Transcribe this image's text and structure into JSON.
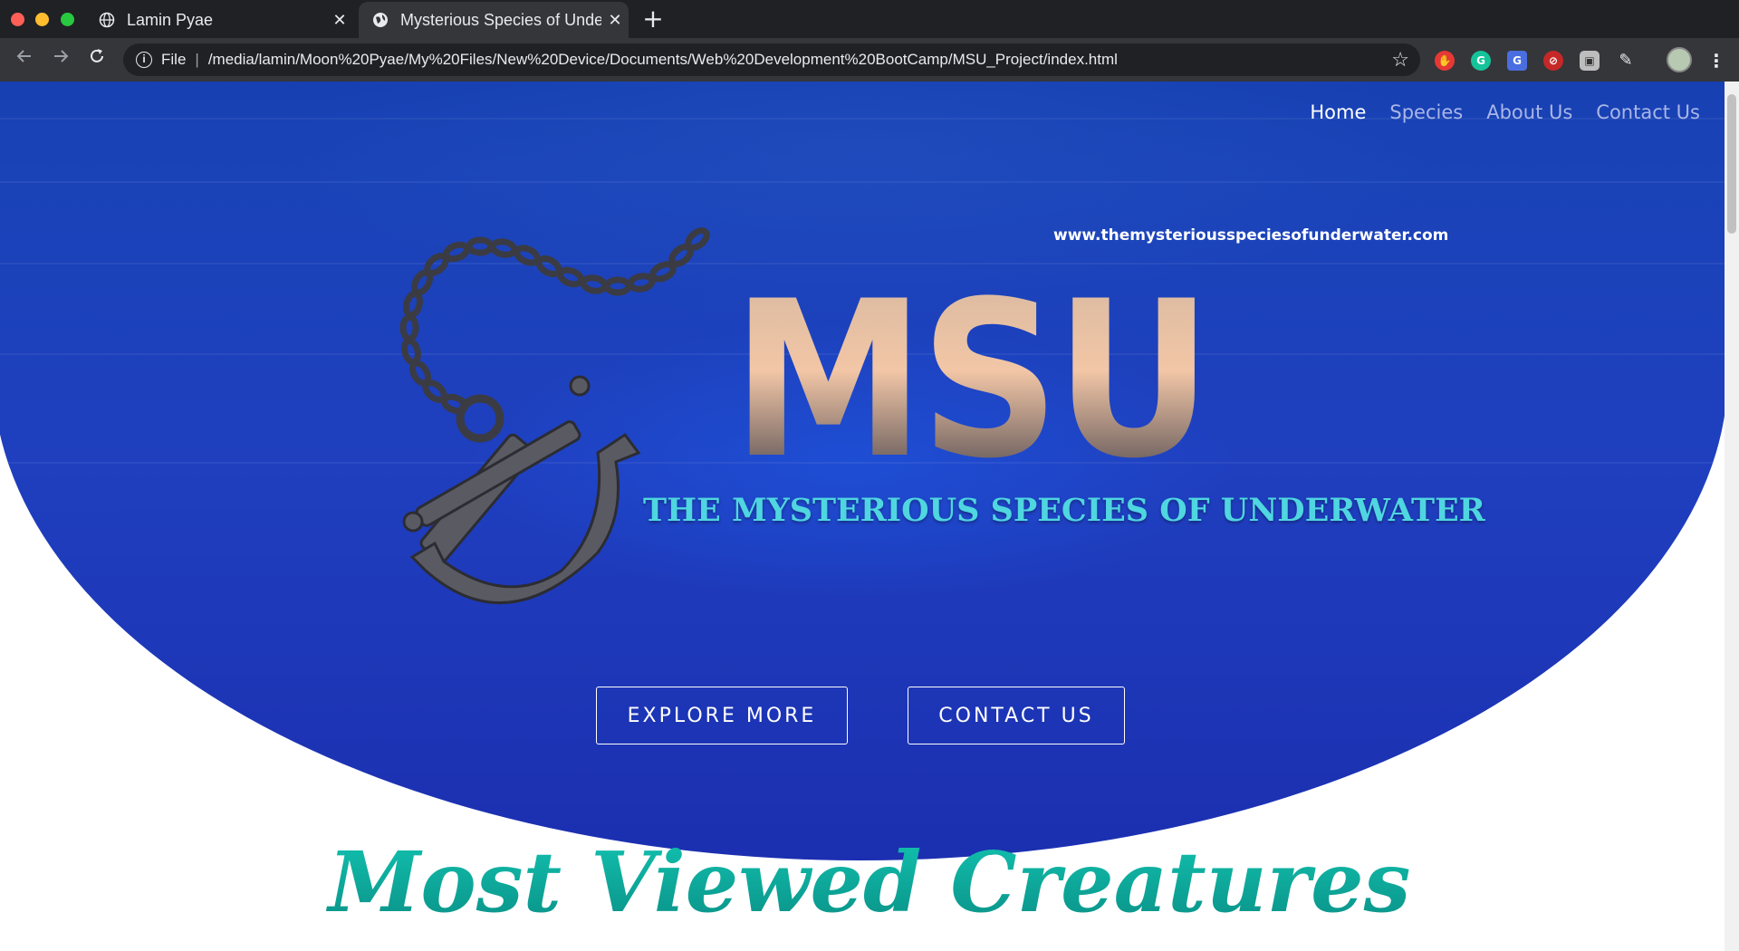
{
  "browser": {
    "tabs": [
      {
        "title": "Lamin Pyae",
        "icon": "globe-icon",
        "active": false
      },
      {
        "title": "Mysterious Species of Underwater",
        "icon": "globe-icon",
        "active": true
      }
    ],
    "close_glyph": "✕",
    "new_tab_glyph": "+",
    "address": {
      "scheme_label": "File",
      "separator": "|",
      "url": "/media/lamin/Moon%20Pyae/My%20Files/New%20Device/Documents/Web%20Development%20BootCamp/MSU_Project/index.html"
    }
  },
  "nav": {
    "items": [
      "Home",
      "Species",
      "About Us",
      "Contact Us"
    ],
    "active_index": 0
  },
  "hero": {
    "site_url": "www.themysteriousspeciesofunderwater.com",
    "logo_text": "MSU",
    "tagline": "THE MYSTERIOUS SPECIES OF  UNDERWATER",
    "buttons": {
      "explore": "EXPLORE MORE",
      "contact": "CONTACT US"
    }
  },
  "section": {
    "title": "Most Viewed Creatures"
  },
  "colors": {
    "hero_blue": "#1a43b8",
    "nav_active": "#ffffff",
    "nav_inactive": "#aab6e8",
    "tagline": "#4fd6e0",
    "section_title": "#0aa59a"
  }
}
